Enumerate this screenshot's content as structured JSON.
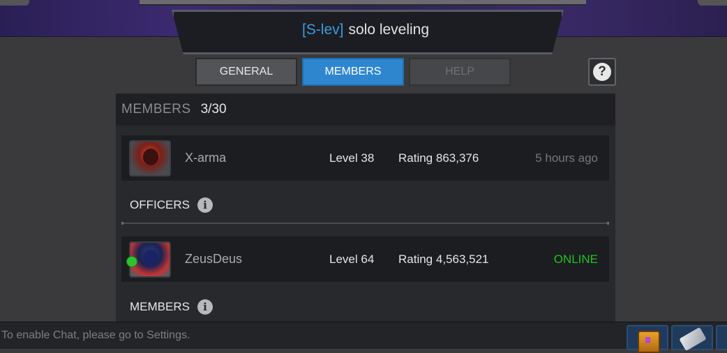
{
  "header": {
    "alliance_tag": "[S-lev]",
    "alliance_name": "solo leveling"
  },
  "tabs": [
    {
      "label": "GENERAL",
      "state": "inactive"
    },
    {
      "label": "MEMBERS",
      "state": "active"
    },
    {
      "label": "HELP",
      "state": "disabled"
    }
  ],
  "help_icon": "question-mark-icon",
  "members_header": {
    "label": "MEMBERS",
    "count": "3/30"
  },
  "leader": {
    "name": "X-arma",
    "level": "Level 38",
    "rating": "Rating 863,376",
    "status": "5 hours ago"
  },
  "officers_section": {
    "label": "OFFICERS",
    "icon": "info-icon"
  },
  "officer": {
    "name": "ZeusDeus",
    "level": "Level 64",
    "rating": "Rating 4,563,521",
    "status": "ONLINE"
  },
  "members_section": {
    "label": "MEMBERS",
    "icon": "info-icon"
  },
  "footer": {
    "chat_notice": "To enable Chat, please go to Settings."
  },
  "colors": {
    "accent_blue": "#2e86cf",
    "tag_blue": "#3d9ae0",
    "online_green": "#22c322"
  }
}
